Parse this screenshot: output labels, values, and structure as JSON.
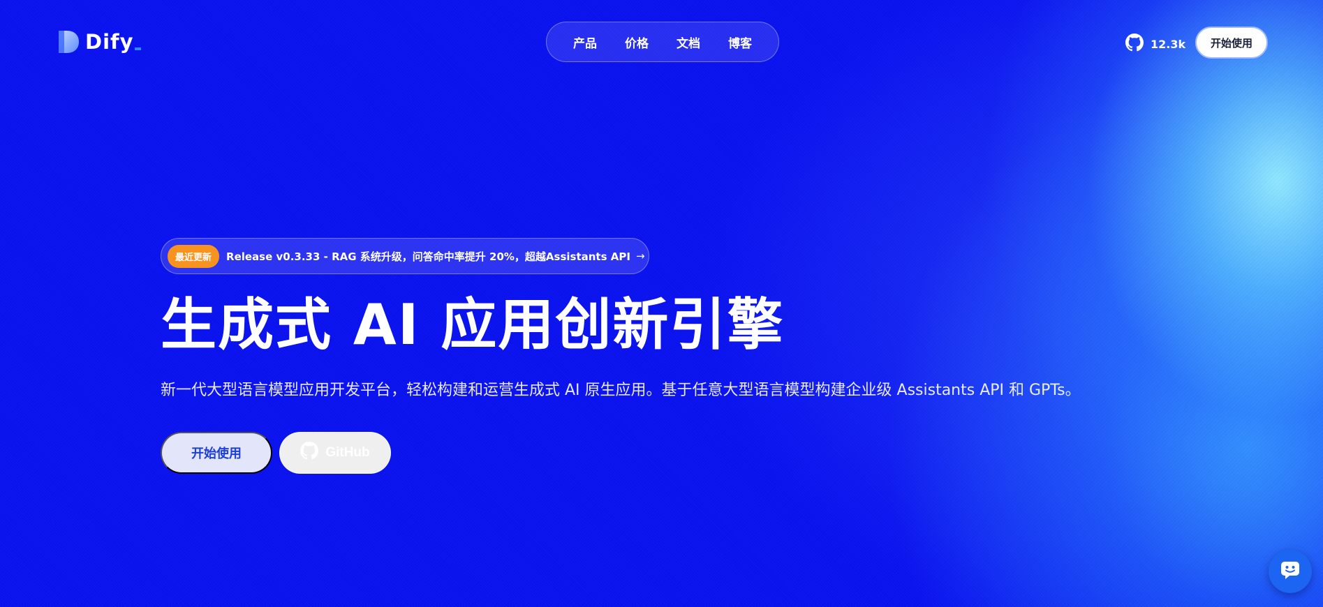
{
  "brand": {
    "name": "Dify",
    "logo_icon": "dify-logo-icon",
    "accent_color": "#2e8bff"
  },
  "nav": {
    "items": [
      {
        "label": "产品"
      },
      {
        "label": "价格"
      },
      {
        "label": "文档"
      },
      {
        "label": "博客"
      }
    ]
  },
  "header": {
    "github_icon": "github-icon",
    "github_stars": "12.3k",
    "cta_label": "开始使用"
  },
  "release": {
    "badge": "最近更新",
    "text": "Release v0.3.33 - RAG 系统升级，问答命中率提升 20%，超越Assistants API",
    "arrow_icon": "arrow-right-icon",
    "badge_color": "#f7931e"
  },
  "hero": {
    "title": "生成式 AI 应用创新引擎",
    "subtitle": "新一代大型语言模型应用开发平台，轻松构建和运营生成式 AI 原生应用。基于任意大型语言模型构建企业级  Assistants API 和 GPTs。",
    "primary_label": "开始使用",
    "secondary_label": "GitHub",
    "secondary_icon": "github-icon"
  },
  "chat": {
    "icon": "chat-bot-icon"
  },
  "colors": {
    "background": "#0a12f0",
    "glow": "#8ee8ff",
    "primary_button_bg": "#e3e6fb",
    "primary_button_text": "#1b3fd8"
  }
}
